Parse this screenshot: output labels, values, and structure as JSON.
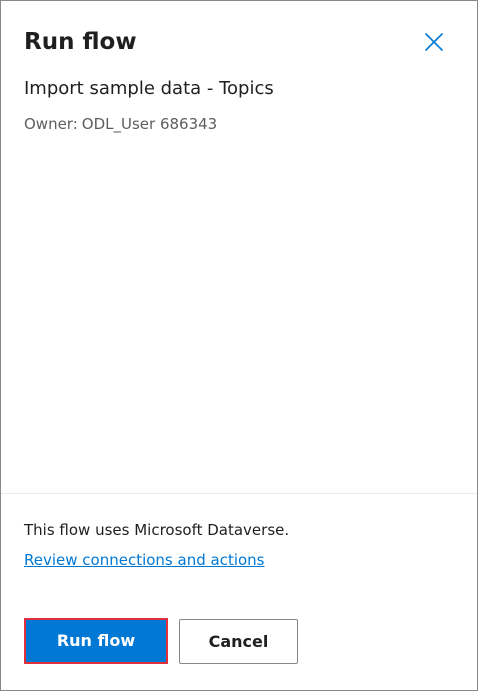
{
  "panel": {
    "title": "Run flow",
    "close_icon": "close-icon"
  },
  "flow": {
    "name": "Import sample data - Topics",
    "owner_prefix": "Owner:",
    "owner_name": "ODL_User 686343"
  },
  "footer": {
    "info_text": "This flow uses Microsoft Dataverse.",
    "review_link": "Review connections and actions",
    "run_label": "Run flow",
    "cancel_label": "Cancel"
  },
  "colors": {
    "accent": "#0078d4",
    "highlight_border": "#e0313c",
    "text_primary": "#201f1e",
    "text_secondary": "#605e5c"
  }
}
